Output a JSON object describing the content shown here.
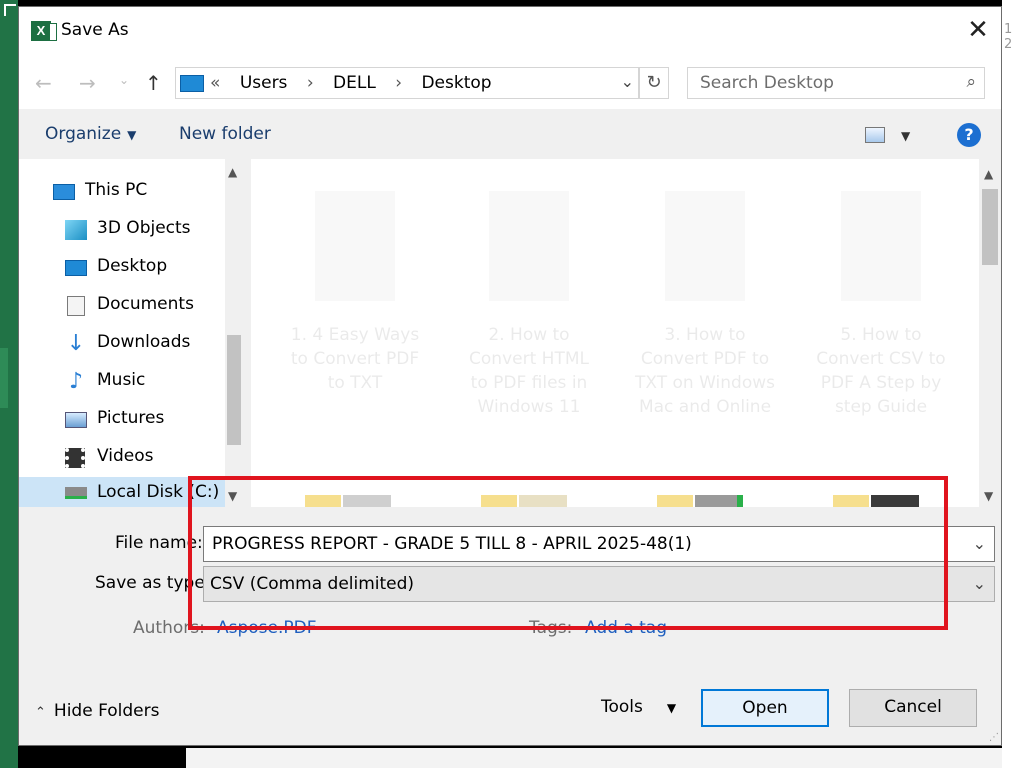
{
  "window": {
    "title": "Save As",
    "close_glyph": "✕"
  },
  "background": {
    "right_fragment": "1 2"
  },
  "navigation": {
    "back_glyph": "←",
    "forward_glyph": "→",
    "recent_glyph": "⌄",
    "up_glyph": "↑",
    "address_prefix": "«",
    "breadcrumbs": [
      "Users",
      "DELL",
      "Desktop"
    ],
    "separator": "›",
    "refresh_glyph": "↻",
    "search_placeholder": "Search Desktop",
    "search_glyph": "⌕"
  },
  "toolbar": {
    "organize_label": "Organize",
    "new_folder_label": "New folder",
    "help_glyph": "?"
  },
  "sidebar": {
    "items": [
      {
        "label": "This PC",
        "icon": "computer-icon"
      },
      {
        "label": "3D Objects",
        "icon": "cube-icon"
      },
      {
        "label": "Desktop",
        "icon": "desktop-icon"
      },
      {
        "label": "Documents",
        "icon": "document-icon"
      },
      {
        "label": "Downloads",
        "icon": "download-arrow-icon"
      },
      {
        "label": "Music",
        "icon": "music-note-icon"
      },
      {
        "label": "Pictures",
        "icon": "picture-icon"
      },
      {
        "label": "Videos",
        "icon": "film-icon"
      },
      {
        "label": "Local Disk (C:)",
        "icon": "drive-icon",
        "selected": true
      }
    ]
  },
  "files": {
    "tiles": [
      {
        "caption": "1. 4 Easy Ways to Convert PDF to TXT"
      },
      {
        "caption": "2. How to Convert HTML to PDF files in Windows 11"
      },
      {
        "caption": "3. How to Convert PDF to TXT on Windows Mac and Online"
      },
      {
        "caption": "5. How to Convert CSV to PDF A Step by step Guide"
      }
    ]
  },
  "form": {
    "file_name_label": "File name:",
    "file_name_value": "PROGRESS REPORT - GRADE 5 TILL 8 - APRIL 2025-48(1)",
    "save_as_type_label": "Save as type:",
    "save_as_type_value": "CSV (Comma delimited)",
    "authors_label": "Authors:",
    "authors_value": "Aspose.PDF",
    "tags_label": "Tags:",
    "tags_value": "Add a tag",
    "dropdown_glyph": "⌄"
  },
  "footer": {
    "hide_folders_label": "Hide Folders",
    "tools_label": "Tools",
    "open_label": "Open",
    "cancel_label": "Cancel"
  },
  "colors": {
    "highlight_border": "#e0141e",
    "accent": "#0078d7",
    "excel_green": "#217346"
  }
}
